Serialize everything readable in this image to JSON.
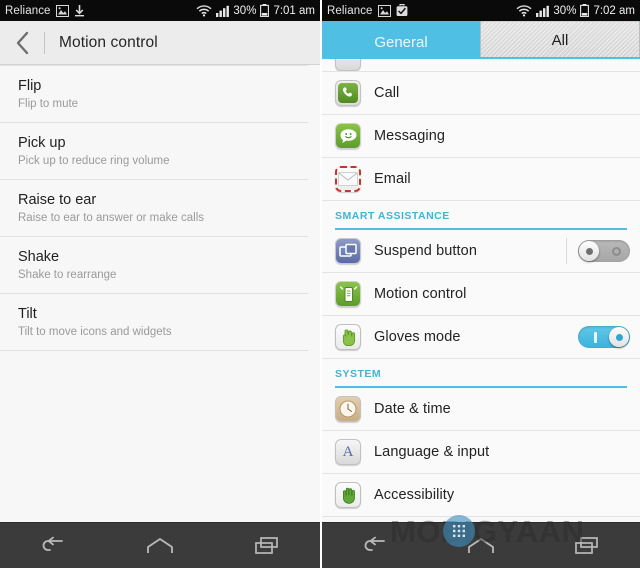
{
  "left_phone": {
    "statusbar": {
      "carrier": "Reliance",
      "icons": [
        "image-icon",
        "download-icon"
      ],
      "wifi": "wifi-icon",
      "signal": "signal-icon",
      "battery_percent": "30%",
      "battery": "battery-icon",
      "time": "7:01 am"
    },
    "actionbar": {
      "back_icon": "back-chevron-icon",
      "title": "Motion control"
    },
    "items": [
      {
        "title": "Flip",
        "subtitle": "Flip to mute"
      },
      {
        "title": "Pick up",
        "subtitle": "Pick up to reduce ring volume"
      },
      {
        "title": "Raise to ear",
        "subtitle": "Raise to ear to answer or make calls"
      },
      {
        "title": "Shake",
        "subtitle": "Shake to rearrange"
      },
      {
        "title": "Tilt",
        "subtitle": "Tilt to move icons and widgets"
      }
    ],
    "navbar": {
      "back": "back-icon",
      "home": "home-icon",
      "recents": "recents-icon"
    }
  },
  "right_phone": {
    "statusbar": {
      "carrier": "Reliance",
      "icons": [
        "image-icon",
        "briefcase-check-icon"
      ],
      "wifi": "wifi-icon",
      "signal": "signal-icon",
      "battery_percent": "30%",
      "battery": "battery-icon",
      "time": "7:02 am"
    },
    "tabs": [
      {
        "label": "General",
        "active": false
      },
      {
        "label": "All",
        "active": true
      }
    ],
    "items": [
      {
        "label": "Call",
        "icon": "phone-icon",
        "type": "link"
      },
      {
        "label": "Messaging",
        "icon": "message-icon",
        "type": "link"
      },
      {
        "label": "Email",
        "icon": "envelope-icon",
        "type": "link"
      }
    ],
    "section_smart": {
      "header": "SMART ASSISTANCE",
      "items": [
        {
          "label": "Suspend button",
          "icon": "suspend-icon",
          "type": "toggle",
          "state": "off"
        },
        {
          "label": "Motion control",
          "icon": "motion-control-icon",
          "type": "link"
        },
        {
          "label": "Gloves mode",
          "icon": "glove-icon",
          "type": "toggle",
          "state": "on"
        }
      ]
    },
    "section_system": {
      "header": "SYSTEM",
      "items": [
        {
          "label": "Date & time",
          "icon": "clock-icon",
          "type": "link"
        },
        {
          "label": "Language & input",
          "icon": "letter-a-icon",
          "type": "link"
        },
        {
          "label": "Accessibility",
          "icon": "hand-icon",
          "type": "link"
        }
      ]
    },
    "navbar": {
      "back": "back-icon",
      "home": "home-icon",
      "recents": "recents-icon"
    }
  },
  "watermark": {
    "text": "MOBIGYAAN",
    "accent": "#3f8fc0"
  },
  "theme": {
    "accent": "#4fc0e4",
    "toggle_on": "#3bb2dd",
    "section_text": "#3fb4da"
  }
}
